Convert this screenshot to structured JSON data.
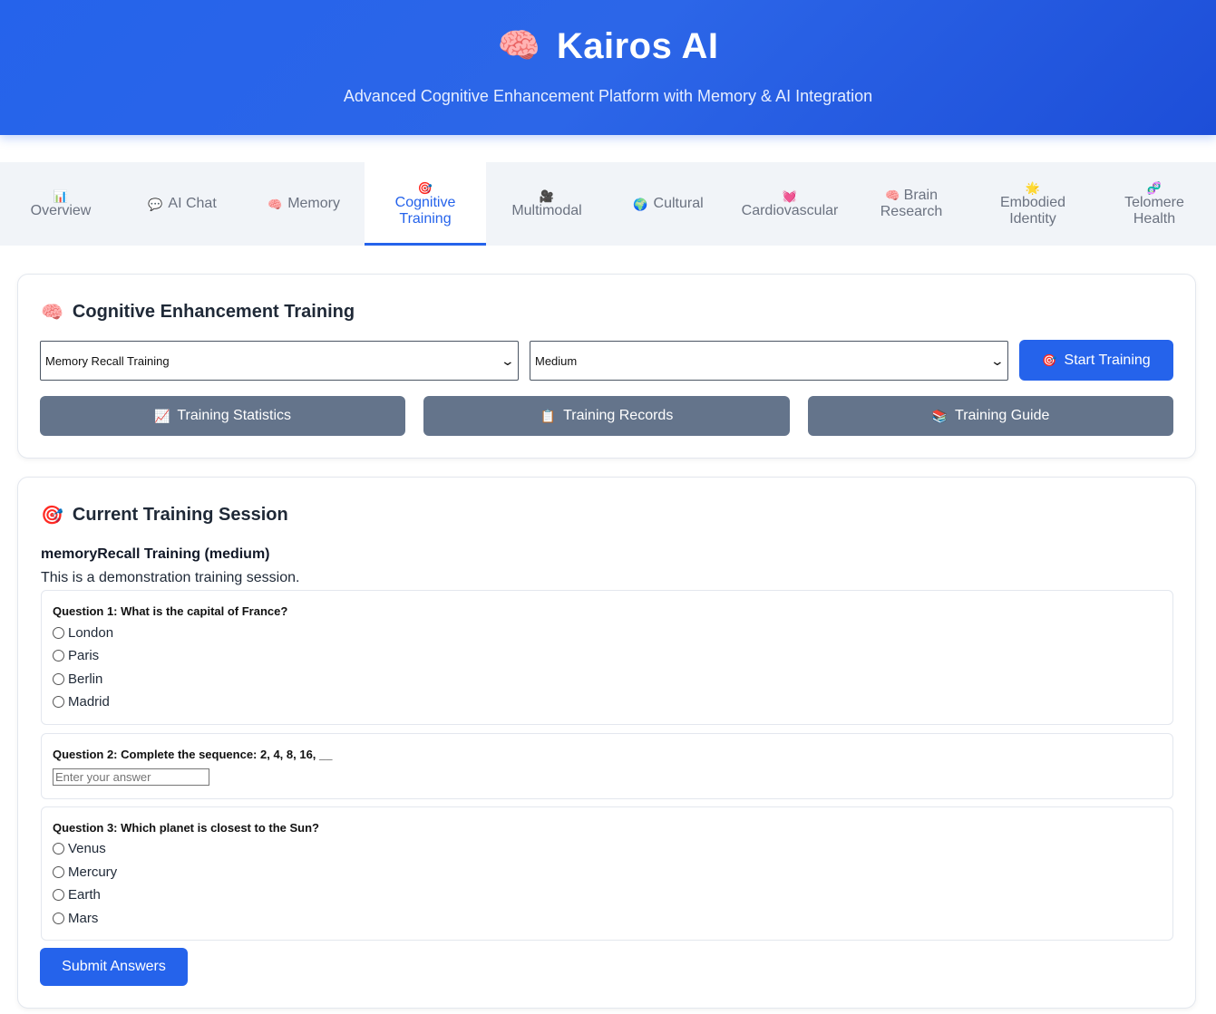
{
  "header": {
    "icon": "brain-icon",
    "icon_glyph": "🧠",
    "title": "Kairos AI",
    "subtitle": "Advanced Cognitive Enhancement Platform with Memory & AI Integration"
  },
  "tabs": [
    {
      "glyph": "📊",
      "label": "Overview",
      "icon": "bar-chart-icon",
      "active": false
    },
    {
      "glyph": "💬",
      "label": "AI Chat",
      "icon": "speech-bubble-icon",
      "active": false
    },
    {
      "glyph": "🧠",
      "label": "Memory",
      "icon": "brain-icon",
      "active": false
    },
    {
      "glyph": "🎯",
      "label": "Cognitive Training",
      "icon": "target-icon",
      "active": true
    },
    {
      "glyph": "🎥",
      "label": "Multimodal",
      "icon": "video-camera-icon",
      "active": false
    },
    {
      "glyph": "🌍",
      "label": "Cultural",
      "icon": "globe-icon",
      "active": false
    },
    {
      "glyph": "💓",
      "label": "Cardiovascular",
      "icon": "heart-icon",
      "active": false
    },
    {
      "glyph": "🧠",
      "label": "Brain Research",
      "icon": "brain-icon",
      "active": false
    },
    {
      "glyph": "🌟",
      "label": "Embodied Identity",
      "icon": "sun-icon",
      "active": false
    },
    {
      "glyph": "🧬",
      "label": "Telomere Health",
      "icon": "dna-icon",
      "active": false
    }
  ],
  "training": {
    "title_glyph": "🧠",
    "title": "Cognitive Enhancement Training",
    "type_select": "Memory Recall Training",
    "difficulty_select": "Medium",
    "start_glyph": "🎯",
    "start_label": "Start Training",
    "stats_glyph": "📈",
    "stats_label": "Training Statistics",
    "records_glyph": "📋",
    "records_label": "Training Records",
    "guide_glyph": "📚",
    "guide_label": "Training Guide"
  },
  "session": {
    "title_glyph": "🎯",
    "title": "Current Training Session",
    "name": "memoryRecall Training (medium)",
    "description": "This is a demonstration training session.",
    "q1": {
      "text": "Question 1: What is the capital of France?",
      "options": [
        "London",
        "Paris",
        "Berlin",
        "Madrid"
      ]
    },
    "q2": {
      "text": "Question 2: Complete the sequence: 2, 4, 8, 16, __",
      "placeholder": "Enter your answer"
    },
    "q3": {
      "text": "Question 3: Which planet is closest to the Sun?",
      "options": [
        "Venus",
        "Mercury",
        "Earth",
        "Mars"
      ]
    },
    "submit_label": "Submit Answers"
  },
  "colors": {
    "primary": "#2563eb",
    "secondary_button": "#64748b",
    "tab_bar": "#f1f4f8"
  }
}
